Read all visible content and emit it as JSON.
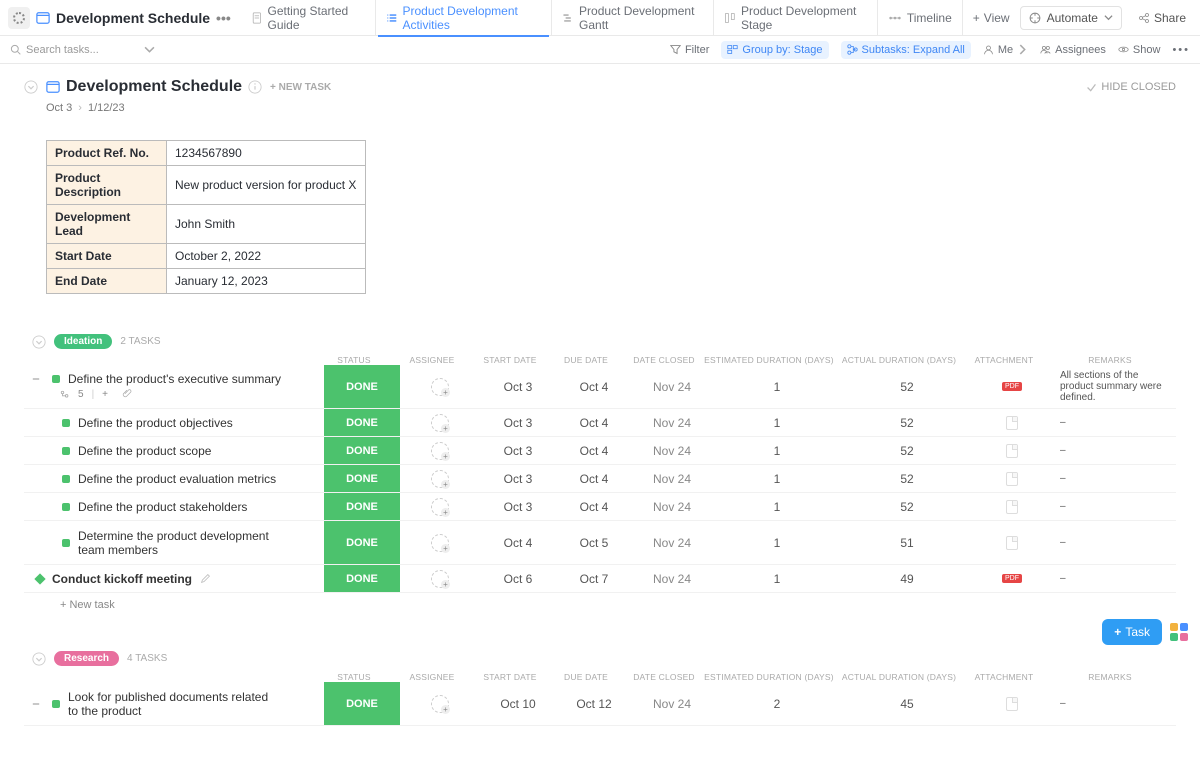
{
  "top": {
    "title": "Development Schedule",
    "tabs": [
      {
        "label": "Getting Started Guide",
        "icon": "doc"
      },
      {
        "label": "Product Development Activities",
        "icon": "list",
        "active": true
      },
      {
        "label": "Product Development Gantt",
        "icon": "gantt"
      },
      {
        "label": "Product Development Stage",
        "icon": "board"
      },
      {
        "label": "Timeline",
        "icon": "timeline"
      }
    ],
    "add_view": "View",
    "automate": "Automate",
    "share": "Share"
  },
  "toolbar": {
    "search_placeholder": "Search tasks...",
    "filter": "Filter",
    "group_by": "Group by: Stage",
    "subtasks": "Subtasks: Expand All",
    "me": "Me",
    "assignees": "Assignees",
    "show": "Show"
  },
  "hdr": {
    "title": "Development Schedule",
    "new_task": "+ NEW TASK",
    "hide_closed": "HIDE CLOSED",
    "date_from": "Oct 3",
    "date_to": "1/12/23"
  },
  "meta": [
    {
      "label": "Product Ref. No.",
      "value": "1234567890"
    },
    {
      "label": "Product Description",
      "value": "New product version for product X"
    },
    {
      "label": "Development Lead",
      "value": "John Smith"
    },
    {
      "label": "Start Date",
      "value": "October 2, 2022"
    },
    {
      "label": "End Date",
      "value": "January 12, 2023"
    }
  ],
  "columns": {
    "status": "STATUS",
    "assignee": "ASSIGNEE",
    "start": "START DATE",
    "due": "DUE DATE",
    "closed": "DATE CLOSED",
    "est": "ESTIMATED DURATION (DAYS)",
    "act": "ACTUAL DURATION (DAYS)",
    "att": "ATTACHMENT",
    "rem": "REMARKS"
  },
  "stages": [
    {
      "name": "Ideation",
      "color": "green",
      "task_count": "2 TASKS",
      "tasks": [
        {
          "name": "Define the product's executive summary",
          "status": "DONE",
          "start": "Oct 3",
          "due": "Oct 4",
          "closed": "Nov 24",
          "est": "1",
          "act": "52",
          "att": "pdf",
          "rem": "All sections of the product summary were defined.",
          "parent": true,
          "sub_count": "5"
        },
        {
          "name": "Define the product objectives",
          "status": "DONE",
          "start": "Oct 3",
          "due": "Oct 4",
          "closed": "Nov 24",
          "est": "1",
          "act": "52",
          "att": "ph",
          "rem": "–"
        },
        {
          "name": "Define the product scope",
          "status": "DONE",
          "start": "Oct 3",
          "due": "Oct 4",
          "closed": "Nov 24",
          "est": "1",
          "act": "52",
          "att": "ph",
          "rem": "–"
        },
        {
          "name": "Define the product evaluation metrics",
          "status": "DONE",
          "start": "Oct 3",
          "due": "Oct 4",
          "closed": "Nov 24",
          "est": "1",
          "act": "52",
          "att": "ph",
          "rem": "–"
        },
        {
          "name": "Define the product stakeholders",
          "status": "DONE",
          "start": "Oct 3",
          "due": "Oct 4",
          "closed": "Nov 24",
          "est": "1",
          "act": "52",
          "att": "ph",
          "rem": "–"
        },
        {
          "name": "Determine the product development team members",
          "status": "DONE",
          "start": "Oct 4",
          "due": "Oct 5",
          "closed": "Nov 24",
          "est": "1",
          "act": "51",
          "att": "ph",
          "rem": "–",
          "wrap": true
        },
        {
          "name": "Conduct kickoff meeting",
          "status": "DONE",
          "start": "Oct 6",
          "due": "Oct 7",
          "closed": "Nov 24",
          "est": "1",
          "act": "49",
          "att": "pdf",
          "rem": "–",
          "diamond": true,
          "editable": true
        }
      ],
      "new_task": "+ New task"
    },
    {
      "name": "Research",
      "color": "pink",
      "task_count": "4 TASKS",
      "tasks": [
        {
          "name": "Look for published documents related to the product",
          "status": "DONE",
          "start": "Oct 10",
          "due": "Oct 12",
          "closed": "Nov 24",
          "est": "2",
          "act": "45",
          "att": "ph",
          "rem": "–",
          "parent": true,
          "wrap": true
        }
      ]
    }
  ],
  "fab": {
    "task": "Task"
  }
}
